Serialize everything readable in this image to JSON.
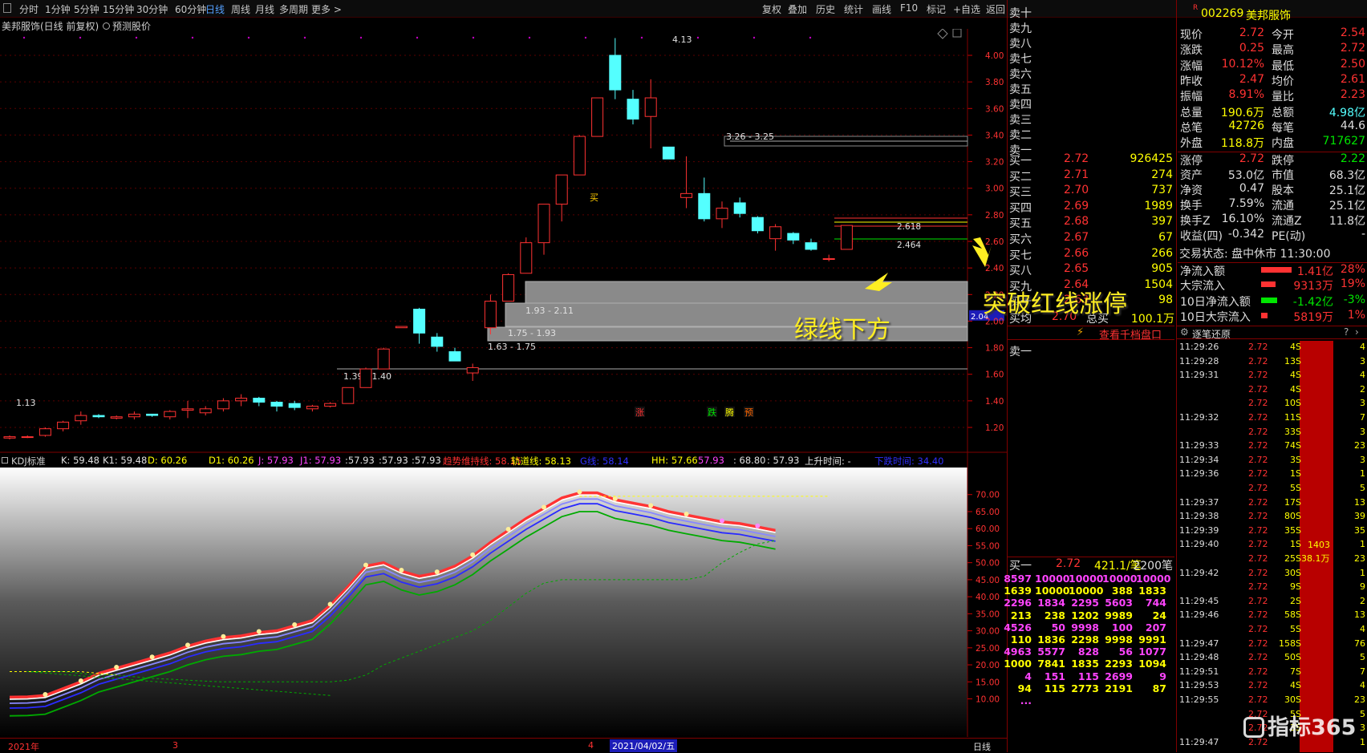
{
  "toolbar": {
    "left": [
      "分时",
      "1分钟",
      "5分钟",
      "15分钟",
      "30分钟",
      "60分钟",
      "日线",
      "周线",
      "月线",
      "多周期",
      "更多 >"
    ],
    "right": [
      "复权",
      "叠加",
      "历史",
      "统计",
      "画线",
      "F10",
      "标记",
      "+自选",
      "返回"
    ]
  },
  "chart_title": "美邦服饰(日线 前复权)",
  "predict_label": "预测股价",
  "chart_data": [
    {
      "type": "candlestick",
      "yticks": [
        "4.00",
        "3.80",
        "3.60",
        "3.40",
        "3.20",
        "3.00",
        "2.80",
        "2.60",
        "2.40",
        "2.20",
        "2.04",
        "2.00",
        "1.80",
        "1.60",
        "1.40",
        "1.20"
      ],
      "high_label": "4.13",
      "low_label": "1.13",
      "zones": [
        "3.26 - 3.25",
        "1.93 - 2.11",
        "1.75 - 1.93",
        "1.63 - 1.75",
        "1.39 - 1.40"
      ],
      "lines": [
        "2.618",
        "2.464"
      ],
      "buy_mark": "买",
      "signal_labels": [
        "涨",
        "跌",
        "腾",
        "预"
      ],
      "candles": [
        [
          1.12,
          1.14,
          1.11,
          1.13
        ],
        [
          1.13,
          1.14,
          1.12,
          1.13
        ],
        [
          1.14,
          1.2,
          1.13,
          1.19
        ],
        [
          1.19,
          1.25,
          1.17,
          1.24
        ],
        [
          1.25,
          1.32,
          1.22,
          1.29
        ],
        [
          1.29,
          1.3,
          1.27,
          1.28
        ],
        [
          1.27,
          1.29,
          1.26,
          1.28
        ],
        [
          1.28,
          1.32,
          1.26,
          1.3
        ],
        [
          1.3,
          1.3,
          1.28,
          1.29
        ],
        [
          1.28,
          1.33,
          1.26,
          1.32
        ],
        [
          1.33,
          1.4,
          1.27,
          1.34
        ],
        [
          1.31,
          1.36,
          1.29,
          1.34
        ],
        [
          1.34,
          1.42,
          1.32,
          1.4
        ],
        [
          1.4,
          1.45,
          1.36,
          1.42
        ],
        [
          1.42,
          1.43,
          1.36,
          1.39
        ],
        [
          1.39,
          1.4,
          1.32,
          1.36
        ],
        [
          1.38,
          1.4,
          1.33,
          1.35
        ],
        [
          1.34,
          1.37,
          1.32,
          1.36
        ],
        [
          1.36,
          1.39,
          1.35,
          1.38
        ],
        [
          1.38,
          1.5,
          1.38,
          1.5
        ],
        [
          1.5,
          1.65,
          1.5,
          1.64
        ],
        [
          1.64,
          1.8,
          1.64,
          1.79
        ],
        [
          1.95,
          1.96,
          1.95,
          1.96
        ],
        [
          2.09,
          2.1,
          1.83,
          1.91
        ],
        [
          1.88,
          1.91,
          1.77,
          1.81
        ],
        [
          1.77,
          1.8,
          1.7,
          1.7
        ],
        [
          1.61,
          1.68,
          1.55,
          1.65
        ],
        [
          1.95,
          2.2,
          1.9,
          2.15
        ],
        [
          2.15,
          2.36,
          2.15,
          2.35
        ],
        [
          2.36,
          2.63,
          2.36,
          2.59
        ],
        [
          2.59,
          2.88,
          2.5,
          2.88
        ],
        [
          2.88,
          3.1,
          2.75,
          3.1
        ],
        [
          3.1,
          3.4,
          3.1,
          3.39
        ],
        [
          3.39,
          3.68,
          3.39,
          3.68
        ],
        [
          4.0,
          4.13,
          3.67,
          3.74
        ],
        [
          3.67,
          3.74,
          3.48,
          3.52
        ],
        [
          3.54,
          3.82,
          3.3,
          3.68
        ],
        [
          3.31,
          3.31,
          3.22,
          3.22
        ],
        [
          2.93,
          3.24,
          2.85,
          2.96
        ],
        [
          2.96,
          3.08,
          2.75,
          2.77
        ],
        [
          2.77,
          2.9,
          2.7,
          2.85
        ],
        [
          2.89,
          2.93,
          2.78,
          2.81
        ],
        [
          2.78,
          2.79,
          2.66,
          2.68
        ],
        [
          2.62,
          2.73,
          2.53,
          2.71
        ],
        [
          2.66,
          2.67,
          2.58,
          2.61
        ],
        [
          2.59,
          2.62,
          2.53,
          2.54
        ],
        [
          2.47,
          2.5,
          2.45,
          2.47
        ],
        [
          2.54,
          2.72,
          2.54,
          2.72
        ]
      ]
    },
    {
      "type": "line",
      "name": "KDJ标准",
      "yticks": [
        "70.00",
        "65.00",
        "60.00",
        "55.00",
        "50.00",
        "45.00",
        "40.00",
        "35.00",
        "30.00",
        "25.00",
        "20.00",
        "15.00",
        "10.00"
      ],
      "ylim": [
        9,
        73
      ]
    }
  ],
  "kdj_header": [
    {
      "t": "KDJ标准",
      "c": "#d0d0d0"
    },
    {
      "t": "K: 59.48",
      "c": "#e0e0e0"
    },
    {
      "t": "K1: 59.48",
      "c": "#e0e0e0"
    },
    {
      "t": "D: 60.26",
      "c": "#ffff00"
    },
    {
      "t": "D1: 60.26",
      "c": "#ffff00"
    },
    {
      "t": "J: 57.93",
      "c": "#ff44ff"
    },
    {
      "t": "J1: 57.93",
      "c": "#ff44ff"
    },
    {
      "t": ":57.93",
      "c": "#e0e0e0"
    },
    {
      "t": ":57.93",
      "c": "#e0e0e0"
    },
    {
      "t": ":57.93",
      "c": "#e0e0e0"
    },
    {
      "t": "趋势维持线: 58.15",
      "c": "#ff3030"
    },
    {
      "t": "轨道线: 58.13",
      "c": "#ffff00"
    },
    {
      "t": "G线: 58.14",
      "c": "#3030ff"
    },
    {
      "t": "HH: 57.66",
      "c": "#ffff00"
    },
    {
      "t": "57.93",
      "c": "#ff44ff"
    },
    {
      "t": ": 68.80",
      "c": "#e0e0e0"
    },
    {
      "t": ": 57.93",
      "c": "#e0e0e0"
    },
    {
      "t": "上升时间: -",
      "c": "#e0e0e0"
    },
    {
      "t": "下跌时间: 34.40",
      "c": "#3030ff"
    }
  ],
  "bottom_dates": [
    "2021年",
    "3",
    "4",
    "2021/04/02/五"
  ],
  "period_tab": "日线",
  "orderbook": {
    "sells": [
      "卖十",
      "卖九",
      "卖八",
      "卖七",
      "卖六",
      "卖五",
      "卖四",
      "卖三",
      "卖二",
      "卖一"
    ],
    "buys": [
      [
        "买一",
        "2.72",
        "926425"
      ],
      [
        "买二",
        "2.71",
        "274"
      ],
      [
        "买三",
        "2.70",
        "737"
      ],
      [
        "买四",
        "2.69",
        "1989"
      ],
      [
        "买五",
        "2.68",
        "397"
      ],
      [
        "买六",
        "2.67",
        "67"
      ],
      [
        "买七",
        "2.66",
        "266"
      ],
      [
        "买八",
        "2.65",
        "905"
      ],
      [
        "买九",
        "2.64",
        "1504"
      ],
      [
        "买十",
        "2.63",
        "98"
      ]
    ],
    "avg": [
      "买均",
      "2.70",
      "总买",
      "100.1万"
    ],
    "view_all": "查看千档盘口",
    "sell1_label": "卖一",
    "buy1": [
      "买一",
      "2.72",
      "421.1/笔",
      "2200笔"
    ],
    "queue": [
      [
        "8597",
        "10000",
        "10000",
        "10000",
        "10000"
      ],
      [
        "1639",
        "10000",
        "10000",
        "388",
        "1833"
      ],
      [
        "2296",
        "1834",
        "2295",
        "5603",
        "744"
      ],
      [
        "213",
        "238",
        "1202",
        "9989",
        "24"
      ],
      [
        "4526",
        "50",
        "9998",
        "100",
        "207"
      ],
      [
        "110",
        "1836",
        "2298",
        "9998",
        "9991"
      ],
      [
        "4963",
        "5577",
        "828",
        "56",
        "1077"
      ],
      [
        "1000",
        "7841",
        "1835",
        "2293",
        "1094"
      ],
      [
        "4",
        "151",
        "115",
        "2699",
        "9"
      ],
      [
        "94",
        "115",
        "2773",
        "2191",
        "87"
      ],
      [
        "...",
        "",
        "",
        "",
        ""
      ]
    ]
  },
  "quote": {
    "code": "002269",
    "name": "美邦服饰",
    "r": "R",
    "rows": [
      [
        "现价",
        "2.72",
        "今开",
        "2.54"
      ],
      [
        "涨跌",
        "0.25",
        "最高",
        "2.72"
      ],
      [
        "涨幅",
        "10.12%",
        "最低",
        "2.50"
      ],
      [
        "昨收",
        "2.47",
        "均价",
        "2.61"
      ],
      [
        "振幅",
        "8.91%",
        "量比",
        "2.23"
      ],
      [
        "总量",
        "190.6万",
        "总额",
        "4.98亿"
      ],
      [
        "总笔",
        "42726",
        "每笔",
        "44.6"
      ],
      [
        "外盘",
        "118.8万",
        "内盘",
        "717627"
      ]
    ],
    "rows2": [
      [
        "涨停",
        "2.72",
        "跌停",
        "2.22"
      ],
      [
        "资产",
        "53.0亿",
        "市值",
        "68.3亿"
      ],
      [
        "净资",
        "0.47",
        "股本",
        "25.1亿"
      ],
      [
        "换手",
        "7.59%",
        "流通",
        "25.1亿"
      ],
      [
        "换手Z",
        "16.10%",
        "流通Z",
        "11.8亿"
      ],
      [
        "收益(四)",
        "-0.342",
        "PE(动)",
        "-"
      ]
    ],
    "status": "交易状态: 盘中休市 11:30:00",
    "flows": [
      [
        "净流入额",
        "1.41亿",
        "28%"
      ],
      [
        "大宗流入",
        "9313万",
        "19%"
      ],
      [
        "10日净流入额",
        "-1.42亿",
        "-3%"
      ],
      [
        "10日大宗流入",
        "5819万",
        "1%"
      ]
    ]
  },
  "ticks_title": "逐笔还原",
  "ticks_vol": "1403",
  "ticks_amt": "38.1万",
  "ticks": [
    [
      "11:29:26",
      "2.72",
      "4S",
      "4"
    ],
    [
      "11:29:28",
      "2.72",
      "13S",
      "3"
    ],
    [
      "11:29:31",
      "2.72",
      "4S",
      "4"
    ],
    [
      "",
      "2.72",
      "4S",
      "2"
    ],
    [
      "",
      "2.72",
      "10S",
      "3"
    ],
    [
      "11:29:32",
      "2.72",
      "11S",
      "7"
    ],
    [
      "",
      "2.72",
      "33S",
      "3"
    ],
    [
      "11:29:33",
      "2.72",
      "74S",
      "23"
    ],
    [
      "11:29:34",
      "2.72",
      "3S",
      "3"
    ],
    [
      "11:29:36",
      "2.72",
      "1S",
      "1"
    ],
    [
      "",
      "2.72",
      "5S",
      "5"
    ],
    [
      "11:29:37",
      "2.72",
      "17S",
      "13"
    ],
    [
      "11:29:38",
      "2.72",
      "80S",
      "39"
    ],
    [
      "11:29:39",
      "2.72",
      "35S",
      "35"
    ],
    [
      "11:29:40",
      "2.72",
      "1S",
      "1"
    ],
    [
      "",
      "2.72",
      "25S",
      "23"
    ],
    [
      "11:29:42",
      "2.72",
      "30S",
      "1"
    ],
    [
      "",
      "2.72",
      "9S",
      "9"
    ],
    [
      "11:29:45",
      "2.72",
      "2S",
      "2"
    ],
    [
      "11:29:46",
      "2.72",
      "58S",
      "13"
    ],
    [
      "",
      "2.72",
      "5S",
      "4"
    ],
    [
      "11:29:47",
      "2.72",
      "158S",
      "76"
    ],
    [
      "11:29:48",
      "2.72",
      "50S",
      "5"
    ],
    [
      "11:29:51",
      "2.72",
      "7S",
      "7"
    ],
    [
      "11:29:53",
      "2.72",
      "4S",
      "4"
    ],
    [
      "11:29:55",
      "2.72",
      "30S",
      "23"
    ],
    [
      "",
      "2.72",
      "5S",
      "5"
    ],
    [
      "",
      "2.72",
      "3S",
      "3"
    ],
    [
      "11:29:47",
      "2.72",
      "",
      "1"
    ]
  ],
  "annotations": {
    "a1": "突破红线涨停",
    "a2": "绿线下方"
  },
  "watermark": "指标365",
  "colors": {
    "red": "#ff3232",
    "cyan": "#54ffff",
    "yellow": "#ffff00",
    "green": "#00e600",
    "blue": "#1c1cff"
  }
}
